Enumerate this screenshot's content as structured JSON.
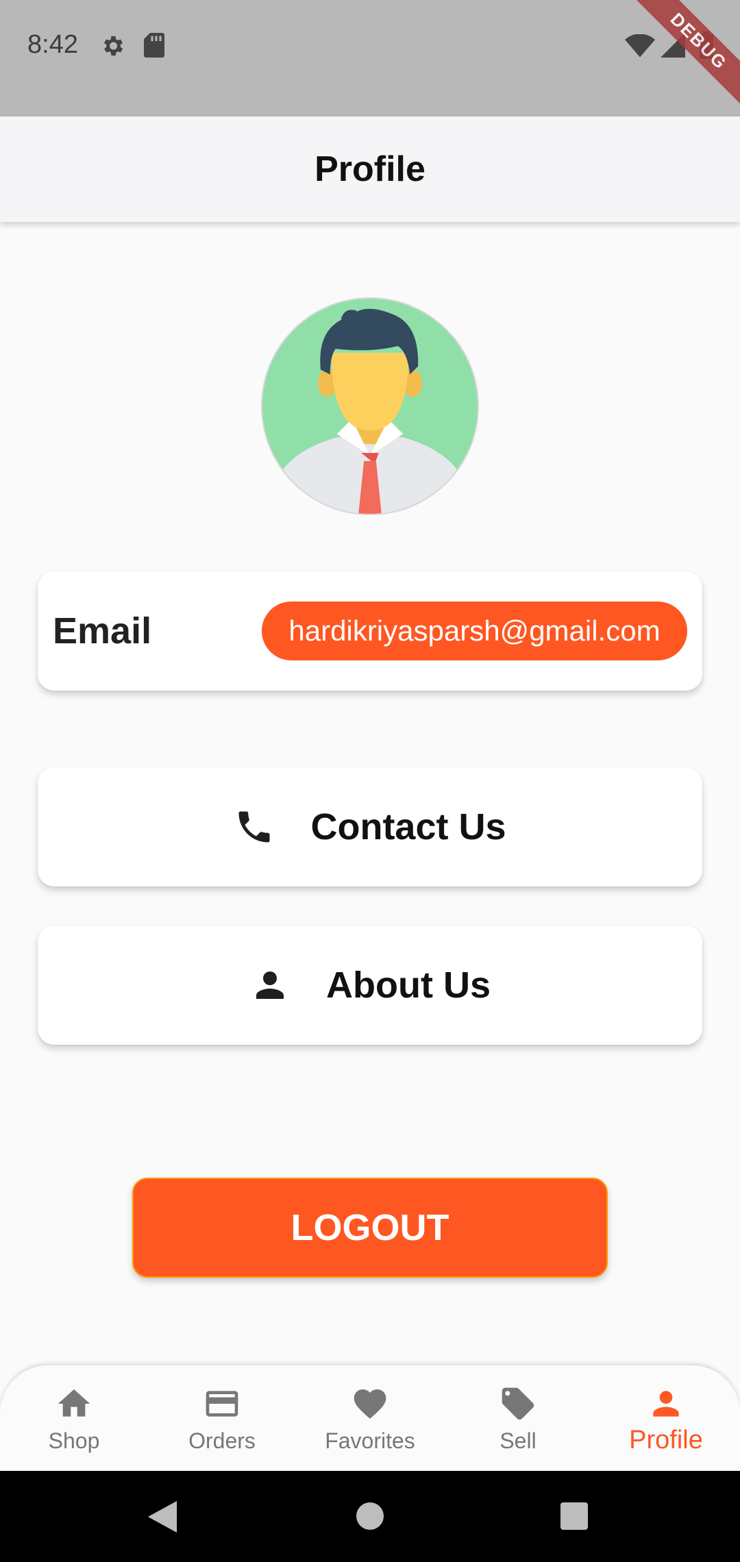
{
  "status_bar": {
    "time": "8:42",
    "debug_label": "DEBUG",
    "icons": [
      "settings-icon",
      "sd-card-icon",
      "wifi-icon",
      "signal-icon",
      "battery-icon"
    ]
  },
  "app_bar": {
    "title": "Profile"
  },
  "profile": {
    "avatar_icon": "user-avatar-illustration",
    "email_label": "Email",
    "email_value": "hardikriyasparsh@gmail.com"
  },
  "actions": {
    "contact_label": "Contact Us",
    "contact_icon": "phone-icon",
    "about_label": "About Us",
    "about_icon": "person-icon"
  },
  "logout_label": "LOGOUT",
  "bottom_nav": {
    "items": [
      {
        "label": "Shop",
        "icon": "home-icon",
        "active": false
      },
      {
        "label": "Orders",
        "icon": "card-icon",
        "active": false
      },
      {
        "label": "Favorites",
        "icon": "heart-icon",
        "active": false
      },
      {
        "label": "Sell",
        "icon": "tag-icon",
        "active": false
      },
      {
        "label": "Profile",
        "icon": "person-icon",
        "active": true
      }
    ]
  },
  "colors": {
    "accent": "#ff5722",
    "inactive": "#777777",
    "status_bar": "#b8b8b8"
  }
}
